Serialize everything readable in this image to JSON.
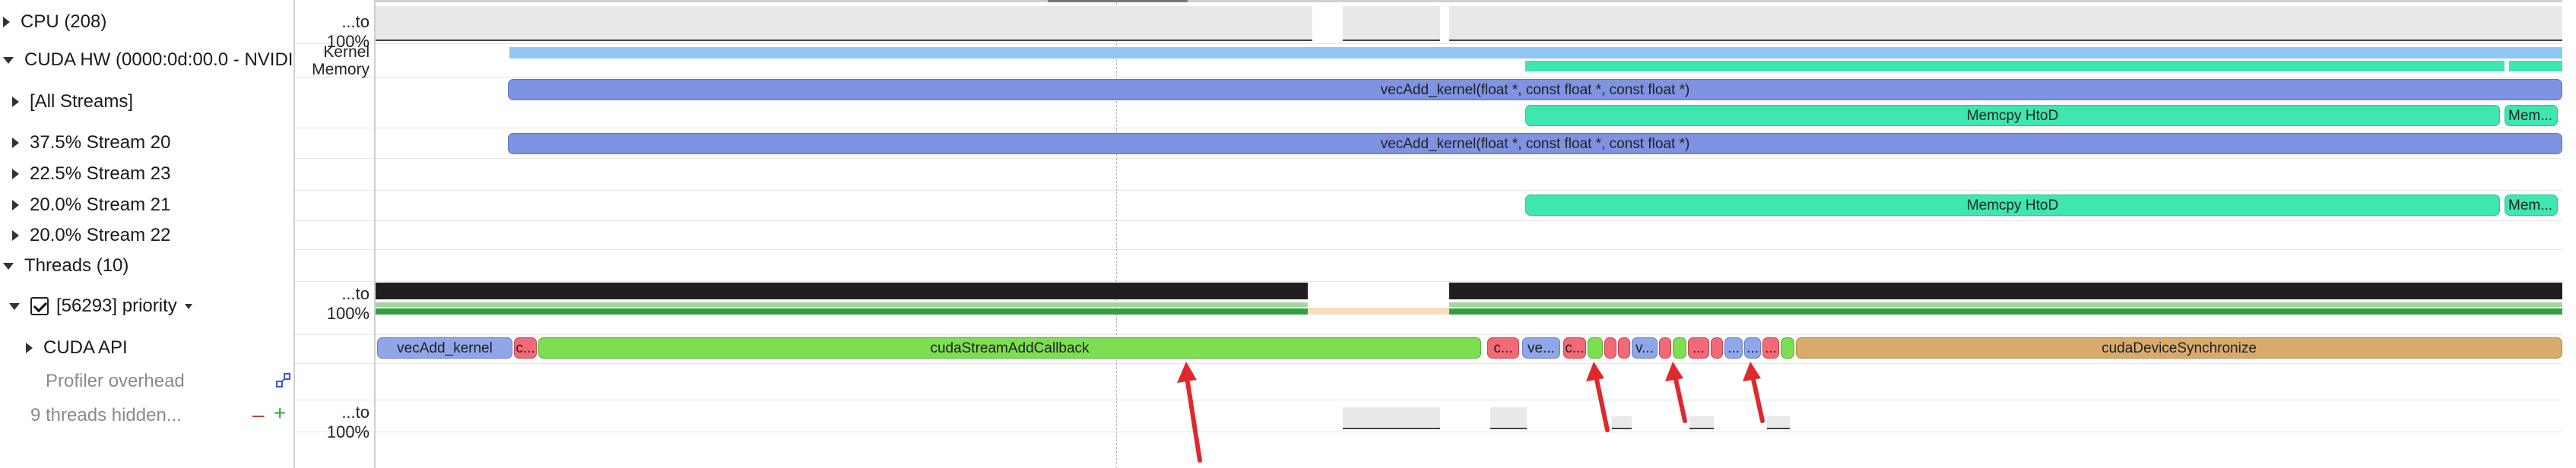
{
  "rows": {
    "cpu": "CPU (208)",
    "cuda_hw": "CUDA HW (0000:0d:00.0 - NVIDI",
    "all_streams": "[All Streams]",
    "stream20": "37.5% Stream 20",
    "stream23": "22.5% Stream 23",
    "stream21": "20.0% Stream 21",
    "stream22": "20.0% Stream 22",
    "threads": "Threads (10)",
    "priority": "[56293] priority",
    "cuda_api": "CUDA API",
    "profiler_overhead": "Profiler overhead",
    "hidden_threads": "9 threads hidden..."
  },
  "scale": {
    "cpu": "...to 100%",
    "kernel": "Kernel",
    "memory": "Memory",
    "thread": "...to 100%",
    "hidden": "...to 100%"
  },
  "events": {
    "vecadd": "vecAdd_kernel(float *, const float *, const float *)",
    "memcpy": "Memcpy HtoD",
    "memcpy_short": "Mem...",
    "api_vecadd": "vecAdd_kernel",
    "api_callback": "cudaStreamAddCallback",
    "api_sync": "cudaDeviceSynchronize",
    "api_c1": "c...",
    "api_c2": "c...",
    "api_ve": "ve...",
    "api_c3": "c...",
    "api_v": "v...",
    "api_d1": "...",
    "api_d2": "...",
    "api_d3": "...",
    "api_d4": "..."
  },
  "colors": {
    "kernel": "#7f93e3",
    "memcpy": "#3ee6b0",
    "api_green": "#7dde53",
    "api_red": "#f26a78",
    "api_tan": "#d7ab6c",
    "arrow": "#e0282c"
  }
}
